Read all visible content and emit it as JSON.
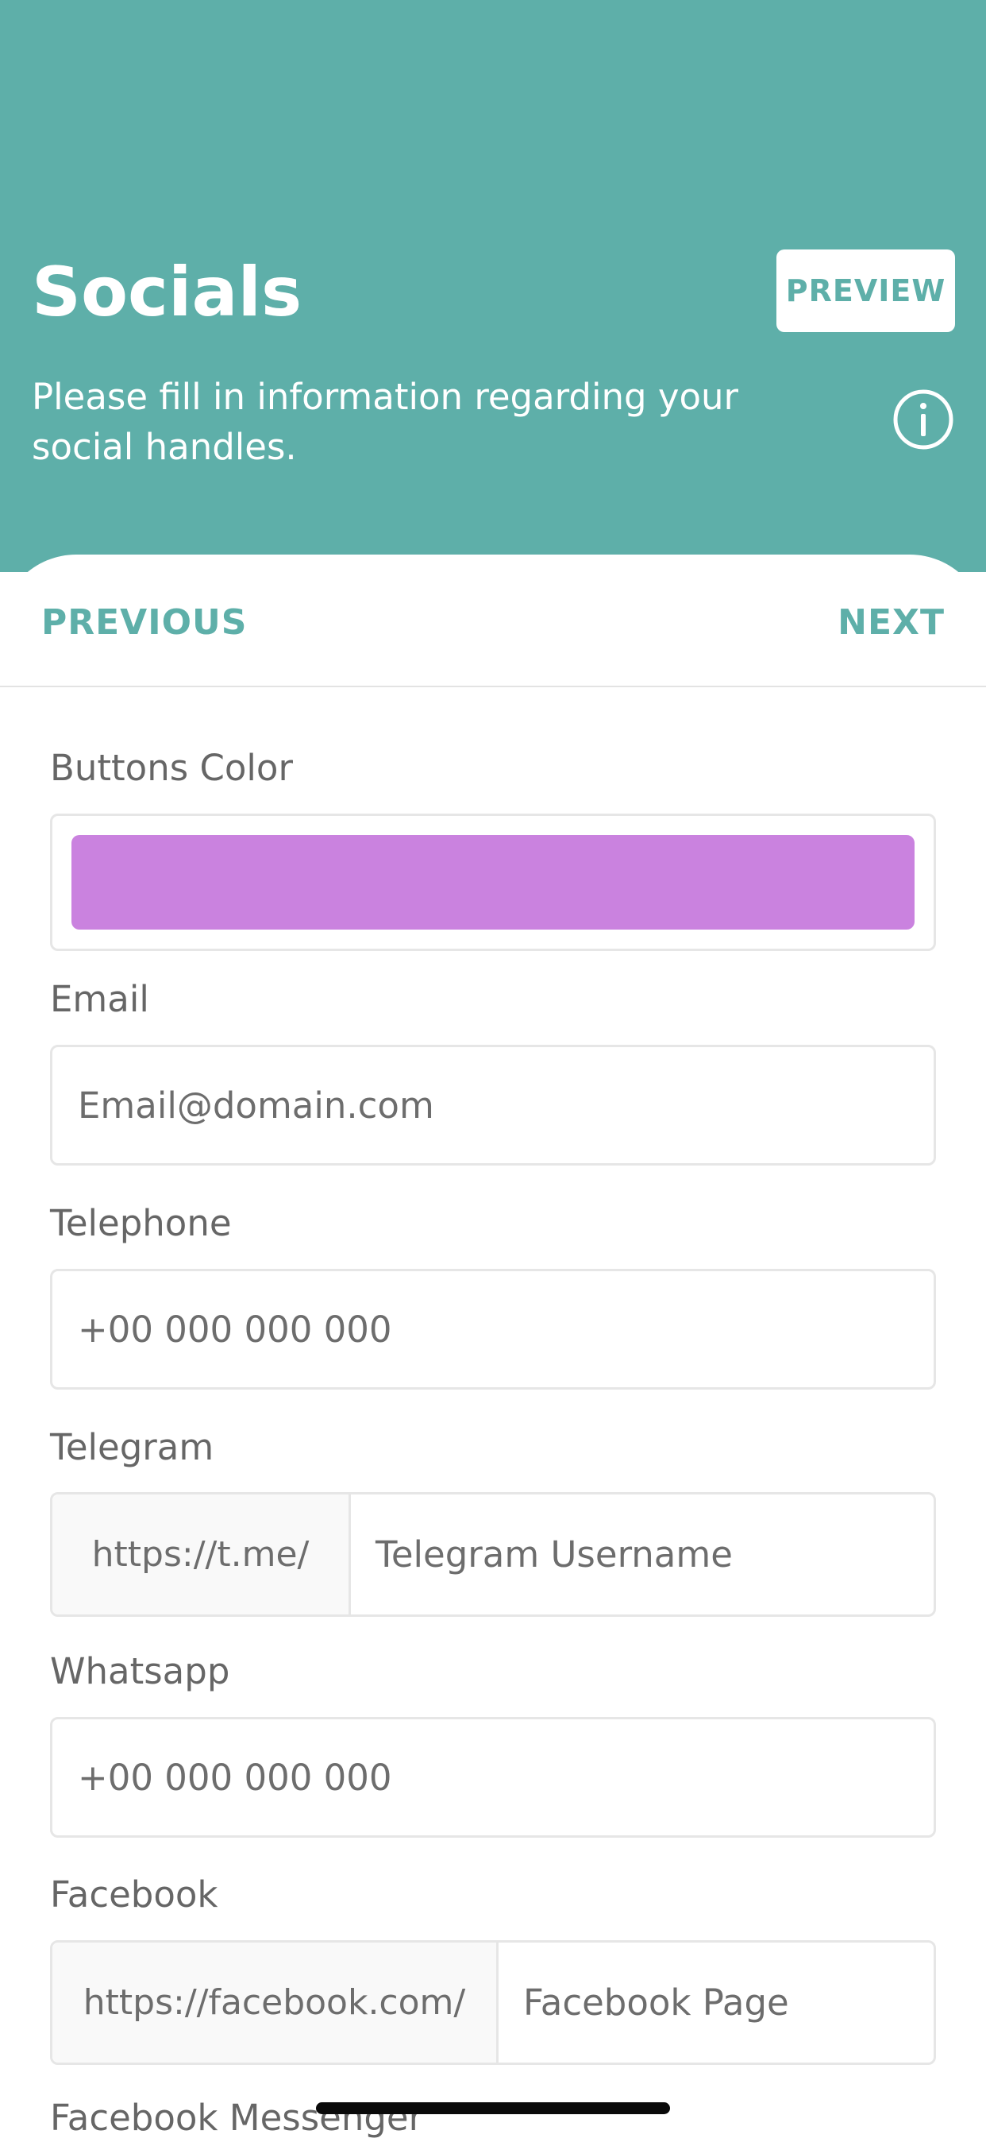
{
  "header": {
    "title": "Socials",
    "preview_label": "PREVIEW",
    "subtitle": "Please fill in information regarding your social handles.",
    "bg_color": "#5eafa9",
    "info_icon": "info-circle-icon"
  },
  "nav": {
    "previous_label": "PREVIOUS",
    "next_label": "NEXT"
  },
  "form": {
    "buttons_color": {
      "label": "Buttons Color",
      "value": "#ca82df"
    },
    "email": {
      "label": "Email",
      "placeholder": "Email@domain.com"
    },
    "telephone": {
      "label": "Telephone",
      "placeholder": "+00 000 000 000"
    },
    "telegram": {
      "label": "Telegram",
      "prefix": "https://t.me/",
      "placeholder": "Telegram Username"
    },
    "whatsapp": {
      "label": "Whatsapp",
      "placeholder": "+00 000 000 000"
    },
    "facebook": {
      "label": "Facebook",
      "prefix": "https://facebook.com/",
      "placeholder": "Facebook Page"
    },
    "facebook_messenger": {
      "label": "Facebook Messenger"
    }
  }
}
